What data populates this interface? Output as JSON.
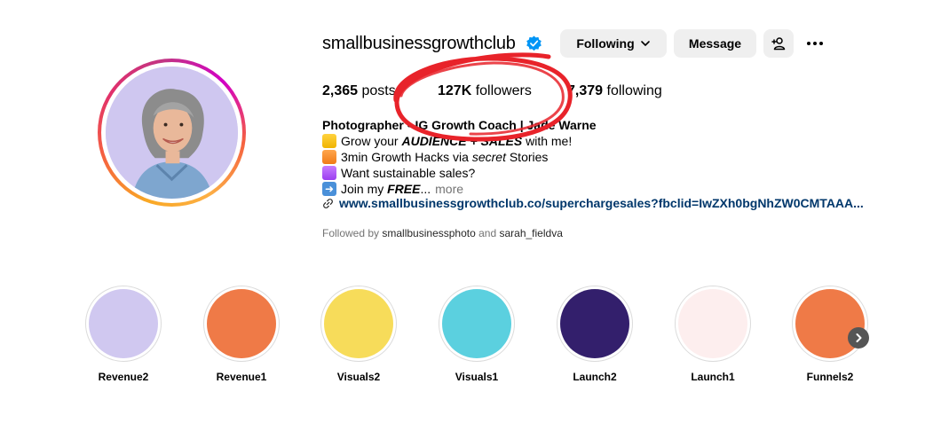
{
  "profile": {
    "username": "smallbusinessgrowthclub",
    "buttons": {
      "following": "Following",
      "message": "Message"
    },
    "stats": {
      "posts_count": "2,365",
      "posts_label": "posts",
      "followers_count": "127K",
      "followers_label": "followers",
      "following_count": "7,379",
      "following_label": "following"
    },
    "bio": {
      "name_line": "Photographer • IG Growth Coach | Jade Warne",
      "line1_a": "Grow your ",
      "line1_b": "AUDIENCE + SALES",
      "line1_c": " with me!",
      "line2_a": "3min Growth Hacks via ",
      "line2_b": "secret",
      "line2_c": " Stories",
      "line3": "Want sustainable sales?",
      "line4_a": "Join my ",
      "line4_b": "FREE",
      "line4_c": "...",
      "more": "more"
    },
    "link": "www.smallbusinessgrowthclub.co/superchargesales?fbclid=IwZXh0bgNhZW0CMTAAA...",
    "followed_by": {
      "prefix": "Followed by ",
      "user1": "smallbusinessphoto",
      "and": " and ",
      "user2": "sarah_fieldva"
    }
  },
  "highlights": [
    {
      "label": "Revenue2",
      "color": "#d0c8f0"
    },
    {
      "label": "Revenue1",
      "color": "#ef7a47"
    },
    {
      "label": "Visuals2",
      "color": "#f7dc5a"
    },
    {
      "label": "Visuals1",
      "color": "#5bd0df"
    },
    {
      "label": "Launch2",
      "color": "#331f6c"
    },
    {
      "label": "Launch1",
      "color": "#fdeeee"
    },
    {
      "label": "Funnels2",
      "color": "#ef7a47"
    }
  ],
  "icons": {
    "verified": "verified-badge-icon",
    "chevron": "chevron-down-icon",
    "add_user": "add-user-icon",
    "more": "more-options-icon",
    "link": "link-icon",
    "next": "chevron-right-icon"
  },
  "colors": {
    "link": "#00376b",
    "button_bg": "#efefef",
    "verified": "#0095f6",
    "annotation": "#e8232a"
  }
}
